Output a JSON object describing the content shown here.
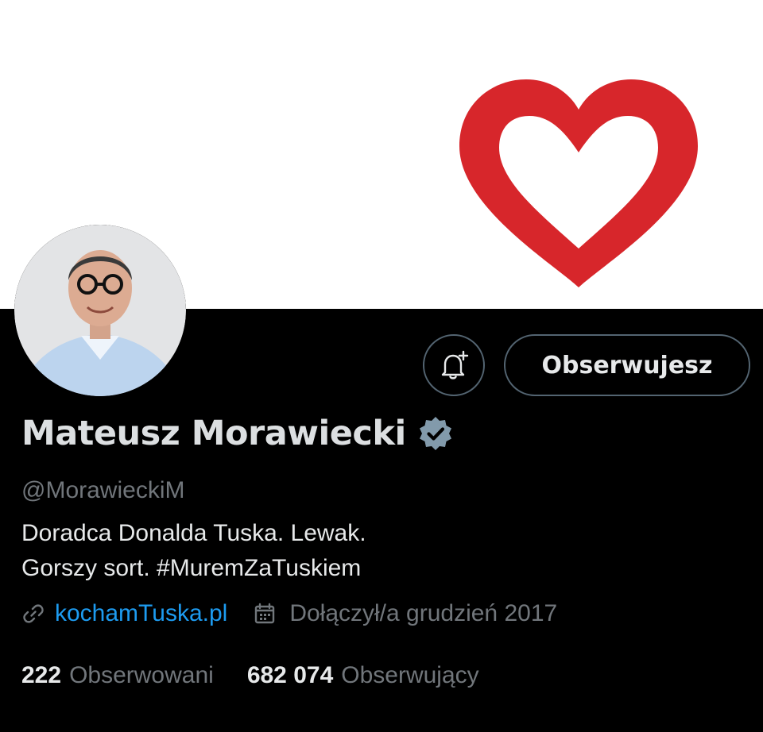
{
  "profile": {
    "display_name": "Mateusz Morawiecki",
    "handle": "@MorawieckiM",
    "bio_line1": "Doradca Donalda Tuska. Lewak.",
    "bio_line2": "Gorszy sort. #MuremZaTuskiem",
    "link": "kochamTuska.pl",
    "joined": "Dołączył/a grudzień 2017",
    "following_count": "222",
    "following_label": "Obserwowani",
    "followers_count": "682 074",
    "followers_label": "Obserwujący"
  },
  "actions": {
    "follow_label": "Obserwujesz"
  },
  "icons": {
    "banner": "heart-icon",
    "bell": "bell-plus-icon",
    "verified": "verified-badge-icon",
    "link": "link-icon",
    "calendar": "calendar-icon"
  },
  "colors": {
    "background": "#000000",
    "heart": "#d7262b",
    "link": "#1d9bf0",
    "secondary_text": "#71767b",
    "verified_badge": "#829aab"
  }
}
